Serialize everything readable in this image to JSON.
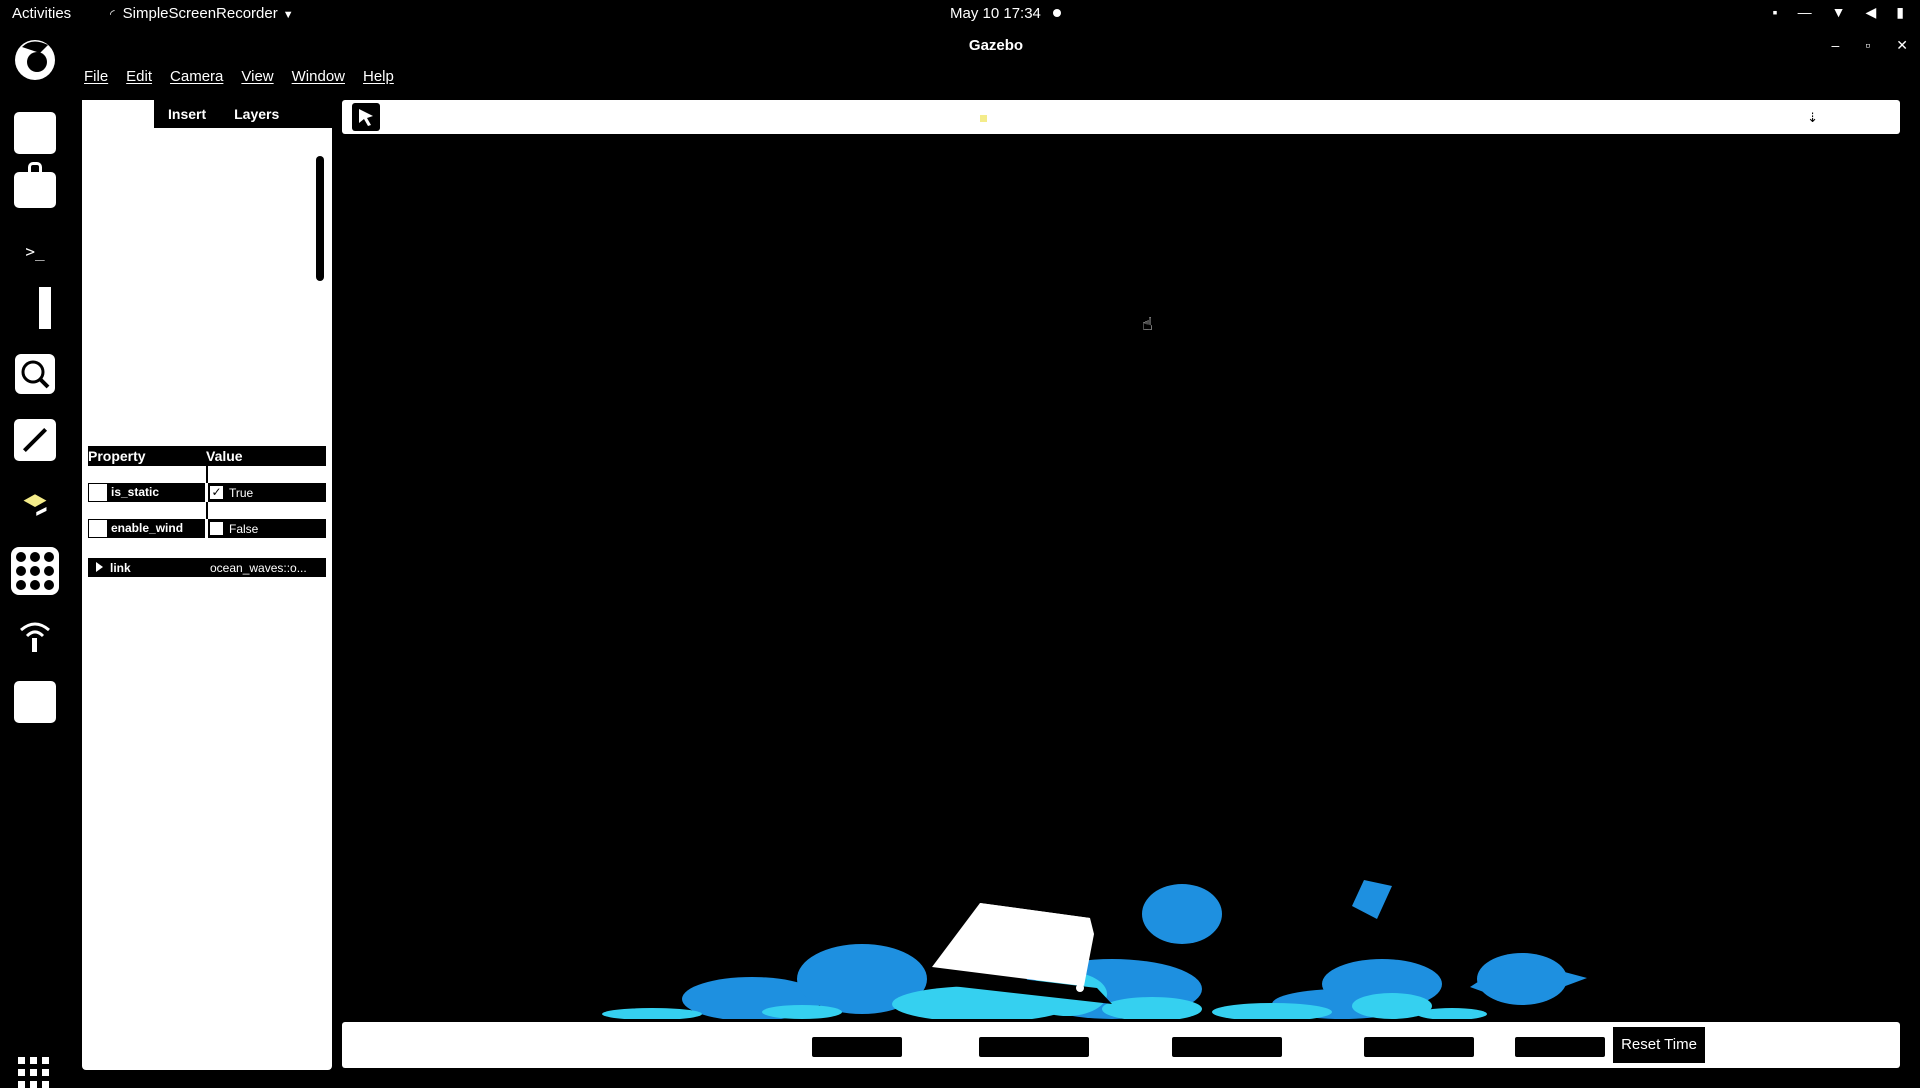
{
  "topbar": {
    "activities": "Activities",
    "app_menu": "SimpleScreenRecorder",
    "clock": "May 10  17:34"
  },
  "window": {
    "title": "Gazebo"
  },
  "menu": {
    "items": [
      "File",
      "Edit",
      "Camera",
      "View",
      "Window",
      "Help"
    ]
  },
  "left_panel": {
    "tabs": [
      "Insert",
      "Layers"
    ],
    "properties": {
      "header": {
        "property": "Property",
        "value": "Value"
      },
      "rows": [
        {
          "name": "is_static",
          "checked": true,
          "value": "True"
        },
        {
          "name": "enable_wind",
          "checked": false,
          "value": "False"
        }
      ],
      "link": {
        "name": "link",
        "value": "ocean_waves::o..."
      }
    }
  },
  "bottom_bar": {
    "reset_time": "Reset Time"
  },
  "colors": {
    "water_dark": "#1e90e0",
    "water_light": "#35d0f0",
    "toolbar_dot": "#f4ec8a"
  }
}
